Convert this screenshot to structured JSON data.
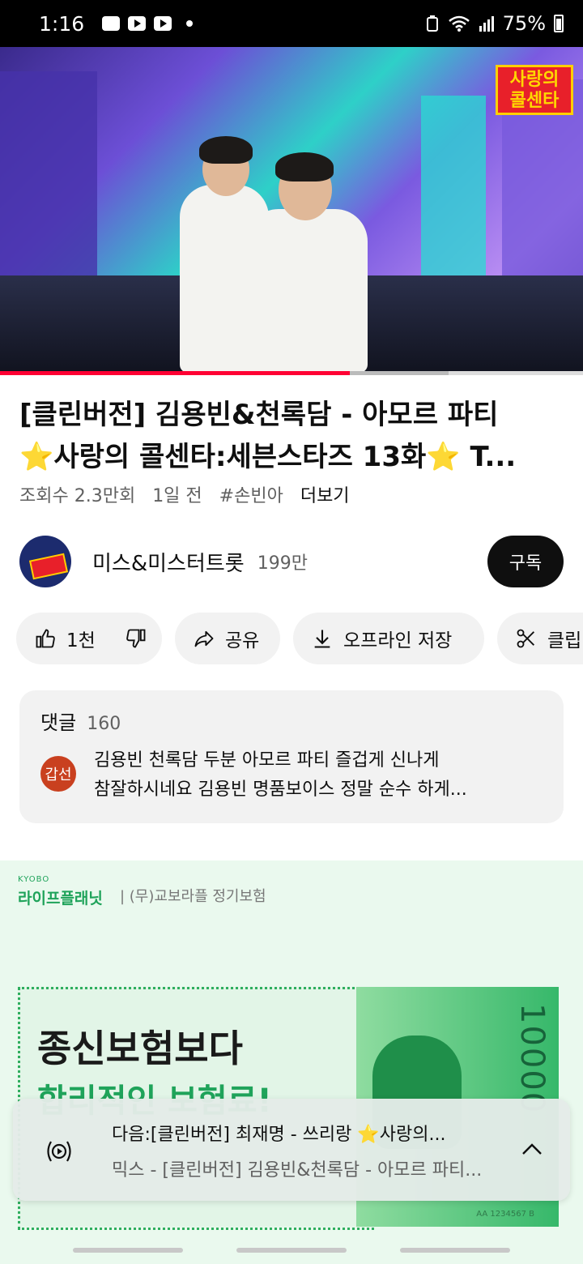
{
  "status_bar": {
    "time": "1:16",
    "battery": "75%",
    "notification_icons": [
      "gallery-icon",
      "youtube-icon",
      "youtube-icon",
      "dot-icon"
    ],
    "system_icons": [
      "recycle-icon",
      "wifi-icon",
      "signal-icon",
      "battery-icon"
    ]
  },
  "video": {
    "overlay_badge_line1": "사랑의",
    "overlay_badge_line2": "콜센타",
    "progress_fraction": 0.6,
    "buffered_fraction": 0.77,
    "progress_color": "#ff0033"
  },
  "title": {
    "line1": "[클린버전] 김용빈&천록담 - 아모르 파티",
    "line2": "⭐사랑의 콜센타:세븐스타즈 13화⭐ T..."
  },
  "meta": {
    "views": "조회수 2.3만회",
    "age": "1일 전",
    "hashtag": "#손빈아",
    "more": "더보기"
  },
  "channel": {
    "name": "미스&미스터트롯",
    "subscribers": "199만",
    "subscribe_label": "구독"
  },
  "actions": {
    "like_count": "1천",
    "share_label": "공유",
    "download_label": "오프라인 저장",
    "clip_label": "클립"
  },
  "comments": {
    "title": "댓글",
    "count": "160",
    "top_comment": {
      "avatar_text": "갑선",
      "line1": "김용빈 천록담 두분 아모르 파티 즐겁게 신나게",
      "line2": "참잘하시네요 김용빈  명품보이스 정말 순수 하게..."
    }
  },
  "ad": {
    "brand_small": "KYOBO",
    "brand": "라이프플래닛",
    "sub": "| (무)교보라플 정기보험",
    "headline": "종신보험보다",
    "headline2": "합리적인 보험료!",
    "bill_number": "10000",
    "bill_serial": "AA 1234567 B",
    "accent_color": "#1fa35a"
  },
  "miniplayer": {
    "next_label": "다음:[클린버전] 최재명 - 쓰리랑 ⭐사랑의...",
    "mix_label": "믹스 - [클린버전] 김용빈&천록담 - 아모르 파티..."
  }
}
